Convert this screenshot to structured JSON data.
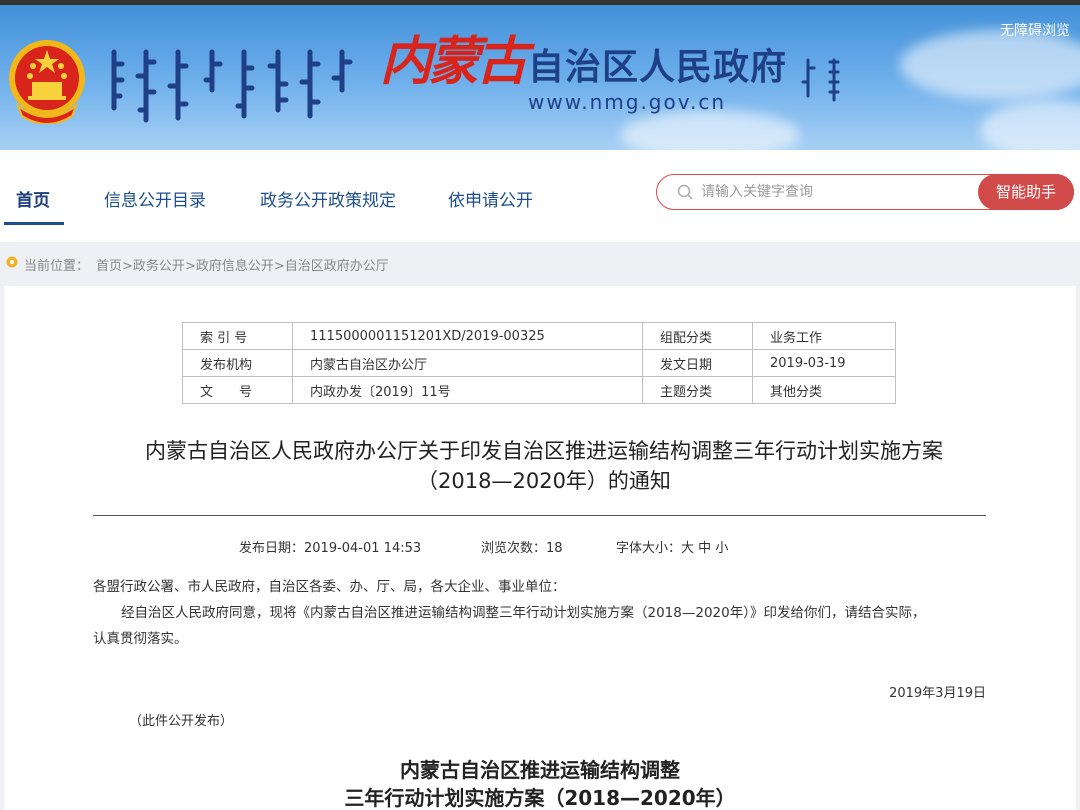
{
  "header": {
    "logo_calligraphy": "内蒙古",
    "site_title": "自治区人民政府",
    "site_url": "www.nmg.gov.cn",
    "accessibility_label": "无障碍浏览"
  },
  "nav": {
    "items": [
      {
        "label": "首页",
        "active": true
      },
      {
        "label": "信息公开目录",
        "active": false
      },
      {
        "label": "政务公开政策规定",
        "active": false
      },
      {
        "label": "依申请公开",
        "active": false
      }
    ],
    "search_placeholder": "请输入关键字查询",
    "smart_assistant_label": "智能助手"
  },
  "breadcrumb": {
    "label": "当前位置：",
    "items": [
      "首页",
      "政务公开",
      "政府信息公开",
      "自治区政府办公厅"
    ],
    "separator": ">"
  },
  "meta_table": {
    "rows": [
      [
        "索 引 号",
        "1115000001151201XD/2019-00325",
        "组配分类",
        "业务工作"
      ],
      [
        "发布机构",
        "内蒙古自治区办公厅",
        "发文日期",
        "2019-03-19"
      ],
      [
        "文　　号",
        "内政办发〔2019〕11号",
        "主题分类",
        "其他分类"
      ]
    ]
  },
  "document": {
    "title_line1": "内蒙古自治区人民政府办公厅关于印发自治区推进运输结构调整三年行动计划实施方案",
    "title_line2": "（2018—2020年）的通知",
    "publish_label": "发布日期：",
    "publish_date": "2019-04-01 14:53",
    "views_label": "浏览次数：",
    "views": "18",
    "font_size_label": "字体大小：",
    "font_sizes": [
      "大",
      "中",
      "小"
    ],
    "salutation": "各盟行政公署、市人民政府，自治区各委、办、厅、局，各大企业、事业单位：",
    "body_line1": "经自治区人民政府同意，现将《内蒙古自治区推进运输结构调整三年行动计划实施方案（2018—2020年）》印发给你们，请结合实际，",
    "body_line2": "认真贯彻落实。",
    "sign_date": "2019年3月19日",
    "release_note": "（此件公开发布）",
    "subtitle_line1": "内蒙古自治区推进运输结构调整",
    "subtitle_line2": "三年行动计划实施方案（2018—2020年）"
  },
  "colors": {
    "banner_top": "#3f8ed8",
    "nav_text": "#1d4e8f",
    "accent_red": "#d24b4b",
    "title_blue": "#1f3f86"
  }
}
